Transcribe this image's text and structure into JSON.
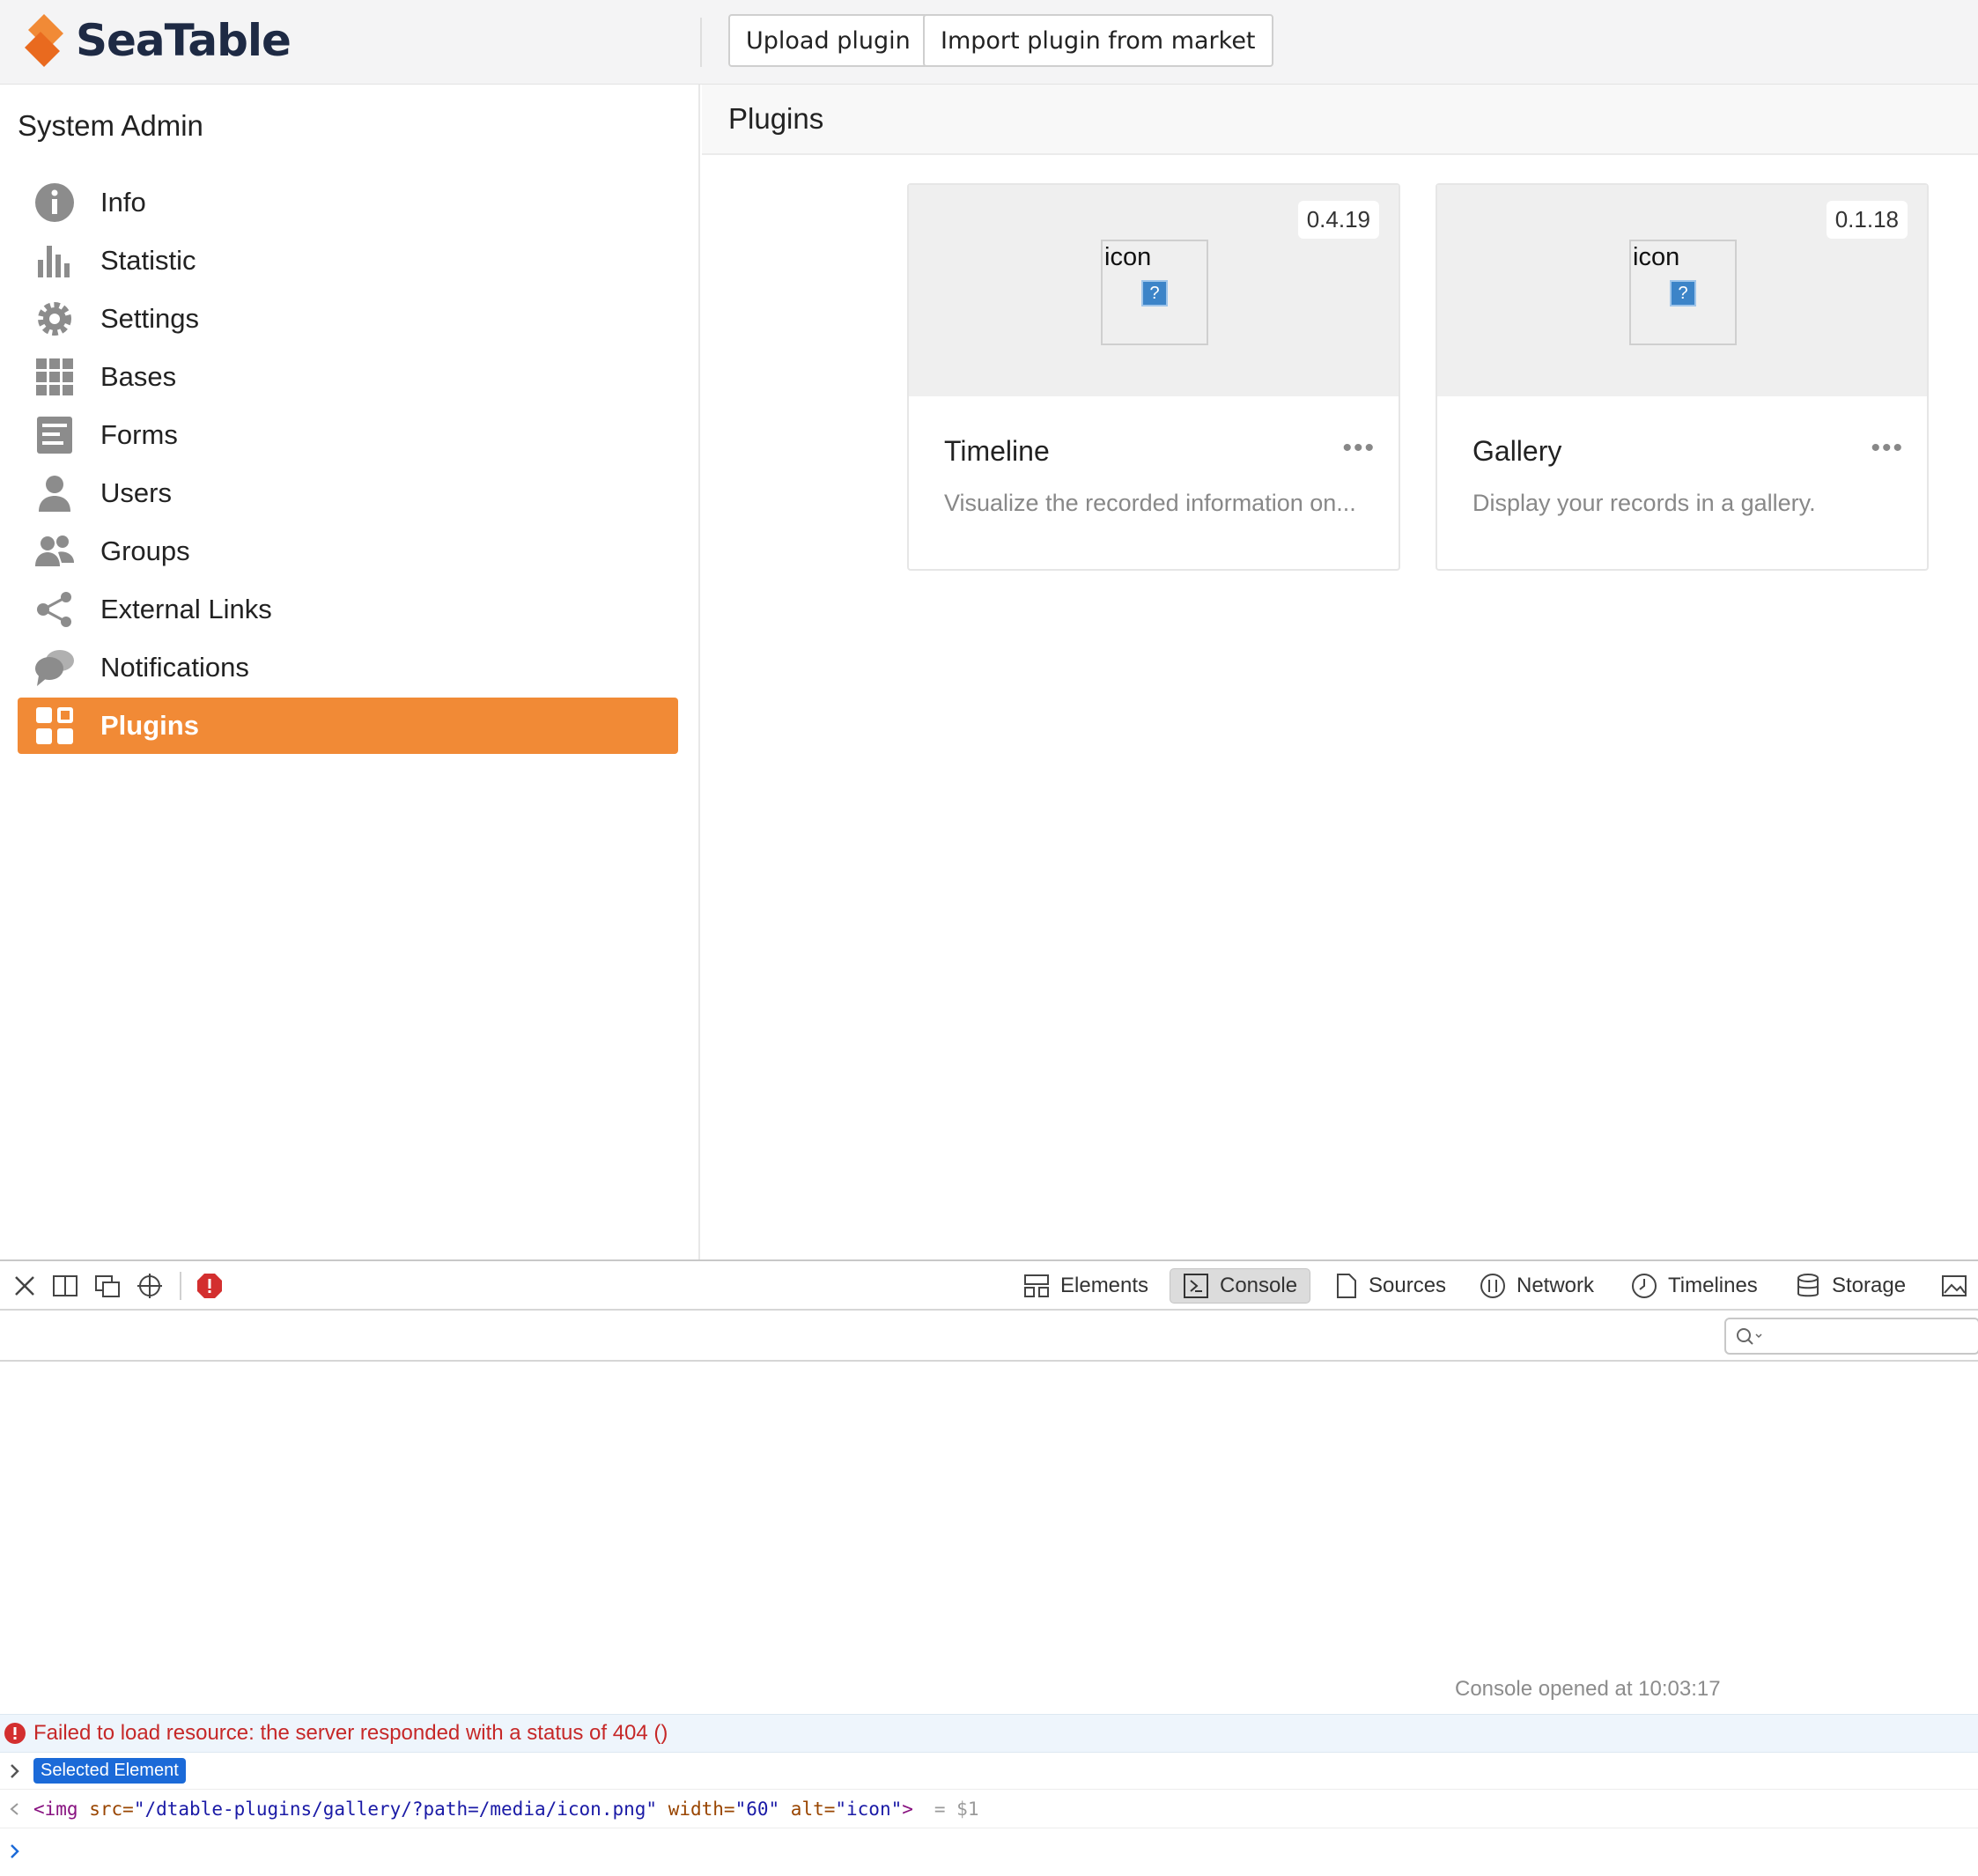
{
  "header": {
    "brand": "SeaTable",
    "upload_label": "Upload plugin",
    "import_label": "Import plugin from market"
  },
  "sidebar": {
    "title": "System Admin",
    "items": [
      {
        "label": "Info",
        "icon": "info-icon"
      },
      {
        "label": "Statistic",
        "icon": "bar-chart-icon"
      },
      {
        "label": "Settings",
        "icon": "gear-icon"
      },
      {
        "label": "Bases",
        "icon": "grid-icon"
      },
      {
        "label": "Forms",
        "icon": "form-icon"
      },
      {
        "label": "Users",
        "icon": "user-icon"
      },
      {
        "label": "Groups",
        "icon": "group-icon"
      },
      {
        "label": "External Links",
        "icon": "share-icon"
      },
      {
        "label": "Notifications",
        "icon": "chat-bubbles-icon"
      },
      {
        "label": "Plugins",
        "icon": "plugins-icon",
        "active": true
      }
    ]
  },
  "main": {
    "title": "Plugins",
    "plugins": [
      {
        "name": "Timeline",
        "version": "0.4.19",
        "icon_alt": "icon",
        "description": "Visualize the recorded information on...",
        "more": "•••"
      },
      {
        "name": "Gallery",
        "version": "0.1.18",
        "icon_alt": "icon",
        "description": "Display your records in a gallery.",
        "more": "•••"
      }
    ]
  },
  "devtools": {
    "tabs": [
      "Elements",
      "Console",
      "Sources",
      "Network",
      "Timelines",
      "Storage"
    ],
    "active_tab": "Console",
    "opened": "Console opened at 10:03:17",
    "error": "Failed to load resource: the server responded with a status of 404 ()",
    "selected_badge": "Selected Element",
    "code": {
      "tag_open": "<img",
      "src_attr": "src=",
      "src_value": "\"/dtable-plugins/gallery/?path=/media/icon.png\"",
      "width_attr": "width=",
      "width_value": "\"60\"",
      "alt_attr": "alt=",
      "alt_value": "\"icon\"",
      "tag_close": ">",
      "result": "= $1"
    }
  },
  "colors": {
    "accent": "#f18a36",
    "brand_dark": "#1e2a44",
    "error": "#c62828",
    "badge": "#1b6ad8"
  }
}
